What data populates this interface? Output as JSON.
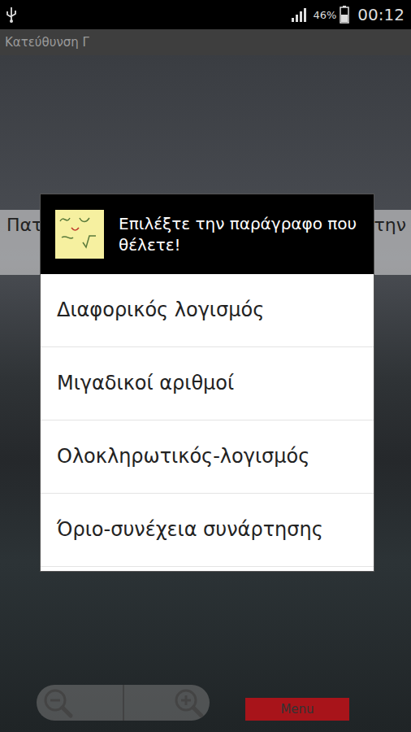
{
  "status_bar": {
    "battery": "46%",
    "time": "00:12"
  },
  "window": {
    "title": "Κατεύθυνση Γ"
  },
  "hint": {
    "left": "Πατ",
    "right": "την"
  },
  "dialog": {
    "title": "Επιλέξτε την παράγραφο που θέλετε!",
    "items": [
      {
        "label": "Διαφορικός λογισμός"
      },
      {
        "label": "Μιγαδικοί αριθμοί"
      },
      {
        "label": "Ολοκληρωτικός-λογισμός"
      },
      {
        "label": "Όριο-συνέχεια συνάρτησης"
      }
    ]
  },
  "bottom": {
    "menu": "Menu"
  }
}
